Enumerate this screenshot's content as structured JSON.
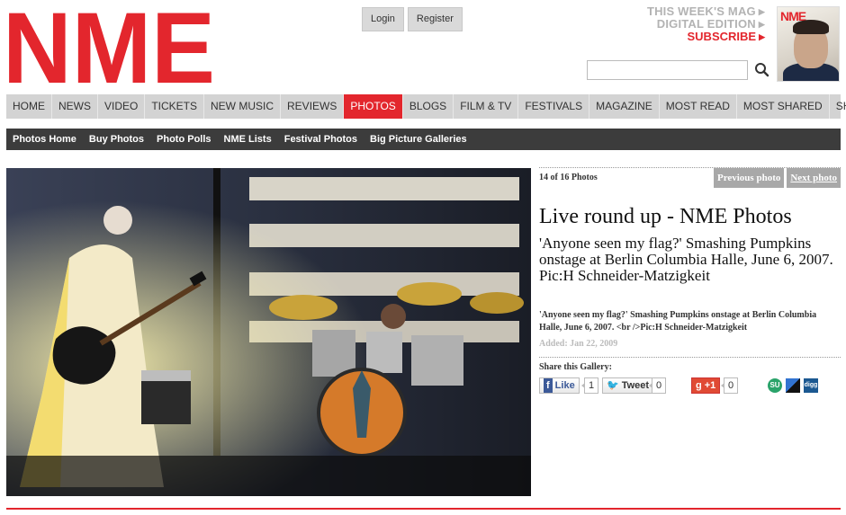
{
  "header": {
    "logo_text": "NME",
    "login_label": "Login",
    "register_label": "Register",
    "promo_line1": "THIS WEEK'S MAG",
    "promo_line2": "DIGITAL EDITION",
    "promo_line3": "SUBSCRIBE",
    "magazine_logo": "NME",
    "search_value": "",
    "search_icon": "magnifier-icon"
  },
  "nav_primary": [
    {
      "label": "HOME",
      "active": false
    },
    {
      "label": "NEWS",
      "active": false
    },
    {
      "label": "VIDEO",
      "active": false
    },
    {
      "label": "TICKETS",
      "active": false
    },
    {
      "label": "NEW MUSIC",
      "active": false
    },
    {
      "label": "REVIEWS",
      "active": false
    },
    {
      "label": "PHOTOS",
      "active": true
    },
    {
      "label": "BLOGS",
      "active": false
    },
    {
      "label": "FILM & TV",
      "active": false
    },
    {
      "label": "FESTIVALS",
      "active": false
    },
    {
      "label": "MAGAZINE",
      "active": false
    },
    {
      "label": "MOST READ",
      "active": false
    },
    {
      "label": "MOST SHARED",
      "active": false
    },
    {
      "label": "SHOP",
      "active": false
    }
  ],
  "nav_secondary": [
    {
      "label": "Photos Home"
    },
    {
      "label": "Buy Photos"
    },
    {
      "label": "Photo Polls"
    },
    {
      "label": "NME Lists"
    },
    {
      "label": "Festival Photos"
    },
    {
      "label": "Big Picture Galleries"
    }
  ],
  "gallery": {
    "counter": "14 of 16 Photos",
    "prev_label": "Previous photo",
    "next_label": "Next photo",
    "title": "Live round up - NME Photos",
    "subtitle": "'Anyone seen my flag?' Smashing Pumpkins onstage at Berlin Columbia Halle, June 6, 2007. Pic:H Schneider-Matzigkeit",
    "description": "'Anyone seen my flag?' Smashing Pumpkins onstage at Berlin Columbia Halle, June 6, 2007. <br />Pic:H Schneider-Matzigkeit",
    "added": "Added: Jan 22, 2009"
  },
  "share": {
    "label": "Share this Gallery:",
    "like_label": "Like",
    "like_count": "1",
    "tweet_label": "Tweet",
    "tweet_count": "0",
    "gplus_label": "+1",
    "gplus_count": "0",
    "stumble_label": "SU",
    "digg_label": "digg"
  },
  "colors": {
    "brand_red": "#e3262d",
    "nav_gray": "#d3d3d3",
    "subnav_dark": "#3c3c3c"
  }
}
